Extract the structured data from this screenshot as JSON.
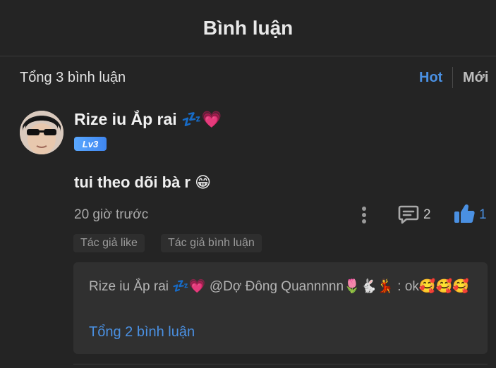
{
  "header": {
    "title": "Bình luận"
  },
  "summary": {
    "count_text": "Tổng 3 bình luận",
    "sort_hot": "Hot",
    "sort_new": "Mới"
  },
  "comment": {
    "username": "Rize iu Ắp rai 💤💗",
    "level": "Lv3",
    "content": "tui theo dõi bà r 😁",
    "time": "20 giờ trước",
    "reply_count": "2",
    "like_count": "1",
    "tags": [
      "Tác giả like",
      "Tác giả bình luận"
    ],
    "reply_preview": {
      "text": "Rize iu Ắp rai 💤💗 @Dợ Đông Quannnnn🌷🐇💃 : ok🥰🥰🥰",
      "more_label": "Tổng 2 bình luận"
    }
  },
  "colors": {
    "background": "#242424",
    "accent": "#4a90e2",
    "reply_box": "#303030"
  },
  "icons": [
    "avatar",
    "more-vertical-icon",
    "comment-icon",
    "thumbs-up-icon"
  ]
}
